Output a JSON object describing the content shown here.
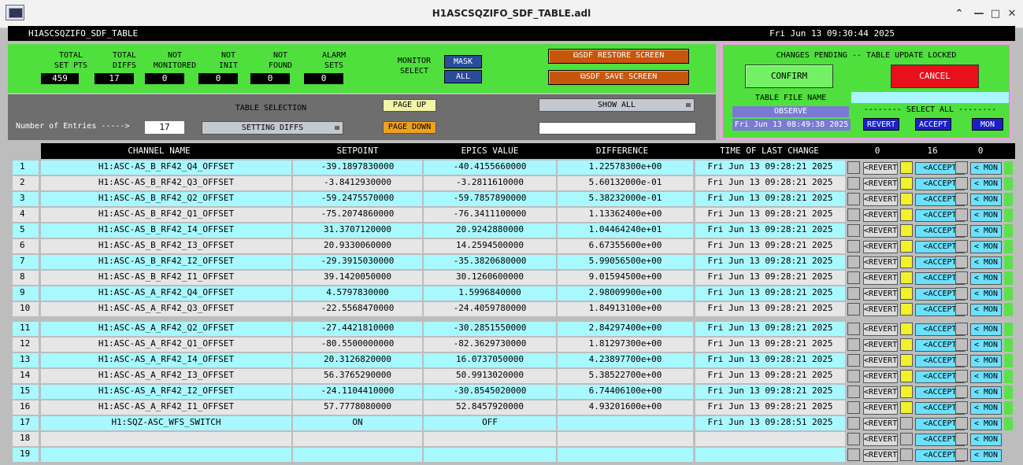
{
  "window_title": "H1ASCSQZIFO_SDF_TABLE.adl",
  "header": {
    "screen_name": "H1ASCSQZIFO_SDF_TABLE",
    "datetime": "Fri Jun 13 09:30:44 2025"
  },
  "stats": [
    {
      "label": "TOTAL\nSET PTS",
      "value": "459"
    },
    {
      "label": "TOTAL\nDIFFS",
      "value": "17"
    },
    {
      "label": "NOT\nMONITORED",
      "value": "0"
    },
    {
      "label": "NOT\nINIT",
      "value": "0"
    },
    {
      "label": "NOT\nFOUND",
      "value": "0"
    },
    {
      "label": "ALARM\nSETS",
      "value": "0"
    }
  ],
  "monitor": {
    "label": "MONITOR\nSELECT",
    "mask": "MASK",
    "all": "ALL"
  },
  "actions": {
    "restore": "SDF RESTORE SCREEN",
    "save": "SDF SAVE SCREEN"
  },
  "pending": {
    "title": "CHANGES PENDING -- TABLE UPDATE LOCKED",
    "confirm": "CONFIRM",
    "cancel": "CANCEL",
    "file_label": "TABLE FILE NAME",
    "file_value": "OBSERVE",
    "file_time": "Fri Jun 13 08:49:38 2025",
    "select_all": "-------- SELECT ALL --------",
    "revert": "REVERT",
    "accept": "ACCEPT",
    "mon": "MON"
  },
  "table_selection": {
    "title": "TABLE SELECTION",
    "entries_label": "Number of Entries ----->",
    "entries": "17",
    "mode": "SETTING DIFFS",
    "page_up": "PAGE UP",
    "page_down": "PAGE DOWN",
    "show_all": "SHOW ALL"
  },
  "columns": {
    "channel": "CHANNEL NAME",
    "setpoint": "SETPOINT",
    "epics": "EPICS VALUE",
    "diff": "DIFFERENCE",
    "time": "TIME OF LAST CHANGE",
    "c_revert": "0",
    "c_accept": "16",
    "c_mon": "0"
  },
  "row_buttons": {
    "revert": "<REVERT",
    "accept": "<ACCEPT",
    "mon": "< MON"
  },
  "rows": [
    {
      "n": "1",
      "ch": "H1:ASC-AS_B_RF42_Q4_OFFSET",
      "sp": "-39.1897830000",
      "ev": "-40.4155660000",
      "df": "1.22578300e+00",
      "t": "Fri Jun 13 09:28:21 2025",
      "acc": true
    },
    {
      "n": "2",
      "ch": "H1:ASC-AS_B_RF42_Q3_OFFSET",
      "sp": "-3.8412930000",
      "ev": "-3.2811610000",
      "df": "5.60132000e-01",
      "t": "Fri Jun 13 09:28:21 2025",
      "acc": true
    },
    {
      "n": "3",
      "ch": "H1:ASC-AS_B_RF42_Q2_OFFSET",
      "sp": "-59.2475570000",
      "ev": "-59.7857890000",
      "df": "5.38232000e-01",
      "t": "Fri Jun 13 09:28:21 2025",
      "acc": true
    },
    {
      "n": "4",
      "ch": "H1:ASC-AS_B_RF42_Q1_OFFSET",
      "sp": "-75.2074860000",
      "ev": "-76.3411100000",
      "df": "1.13362400e+00",
      "t": "Fri Jun 13 09:28:21 2025",
      "acc": true
    },
    {
      "n": "5",
      "ch": "H1:ASC-AS_B_RF42_I4_OFFSET",
      "sp": "31.3707120000",
      "ev": "20.9242880000",
      "df": "1.04464240e+01",
      "t": "Fri Jun 13 09:28:21 2025",
      "acc": true
    },
    {
      "n": "6",
      "ch": "H1:ASC-AS_B_RF42_I3_OFFSET",
      "sp": "20.9330060000",
      "ev": "14.2594500000",
      "df": "6.67355600e+00",
      "t": "Fri Jun 13 09:28:21 2025",
      "acc": true
    },
    {
      "n": "7",
      "ch": "H1:ASC-AS_B_RF42_I2_OFFSET",
      "sp": "-29.3915030000",
      "ev": "-35.3820680000",
      "df": "5.99056500e+00",
      "t": "Fri Jun 13 09:28:21 2025",
      "acc": true
    },
    {
      "n": "8",
      "ch": "H1:ASC-AS_B_RF42_I1_OFFSET",
      "sp": "39.1420050000",
      "ev": "30.1260600000",
      "df": "9.01594500e+00",
      "t": "Fri Jun 13 09:28:21 2025",
      "acc": true
    },
    {
      "n": "9",
      "ch": "H1:ASC-AS_A_RF42_Q4_OFFSET",
      "sp": "4.5797830000",
      "ev": "1.5996840000",
      "df": "2.98009900e+00",
      "t": "Fri Jun 13 09:28:21 2025",
      "acc": true
    },
    {
      "n": "10",
      "ch": "H1:ASC-AS_A_RF42_Q3_OFFSET",
      "sp": "-22.5568470000",
      "ev": "-24.4059780000",
      "df": "1.84913100e+00",
      "t": "Fri Jun 13 09:28:21 2025",
      "acc": true
    },
    {
      "n": "11",
      "ch": "H1:ASC-AS_A_RF42_Q2_OFFSET",
      "sp": "-27.4421810000",
      "ev": "-30.2851550000",
      "df": "2.84297400e+00",
      "t": "Fri Jun 13 09:28:21 2025",
      "acc": true
    },
    {
      "n": "12",
      "ch": "H1:ASC-AS_A_RF42_Q1_OFFSET",
      "sp": "-80.5500000000",
      "ev": "-82.3629730000",
      "df": "1.81297300e+00",
      "t": "Fri Jun 13 09:28:21 2025",
      "acc": true
    },
    {
      "n": "13",
      "ch": "H1:ASC-AS_A_RF42_I4_OFFSET",
      "sp": "20.3126820000",
      "ev": "16.0737050000",
      "df": "4.23897700e+00",
      "t": "Fri Jun 13 09:28:21 2025",
      "acc": true
    },
    {
      "n": "14",
      "ch": "H1:ASC-AS_A_RF42_I3_OFFSET",
      "sp": "56.3765290000",
      "ev": "50.9913020000",
      "df": "5.38522700e+00",
      "t": "Fri Jun 13 09:28:21 2025",
      "acc": true
    },
    {
      "n": "15",
      "ch": "H1:ASC-AS_A_RF42_I2_OFFSET",
      "sp": "-24.1104410000",
      "ev": "-30.8545020000",
      "df": "6.74406100e+00",
      "t": "Fri Jun 13 09:28:21 2025",
      "acc": true
    },
    {
      "n": "16",
      "ch": "H1:ASC-AS_A_RF42_I1_OFFSET",
      "sp": "57.7778080000",
      "ev": "52.8457920000",
      "df": "4.93201600e+00",
      "t": "Fri Jun 13 09:28:21 2025",
      "acc": true
    },
    {
      "n": "17",
      "ch": "H1:SQZ-ASC_WFS_SWITCH",
      "sp": "ON",
      "ev": "OFF",
      "df": "",
      "t": "Fri Jun 13 09:28:51 2025",
      "acc": false
    },
    {
      "n": "18",
      "ch": "",
      "sp": "",
      "ev": "",
      "df": "",
      "t": "",
      "acc": false
    },
    {
      "n": "19",
      "ch": "",
      "sp": "",
      "ev": "",
      "df": "",
      "t": "",
      "acc": false
    }
  ]
}
